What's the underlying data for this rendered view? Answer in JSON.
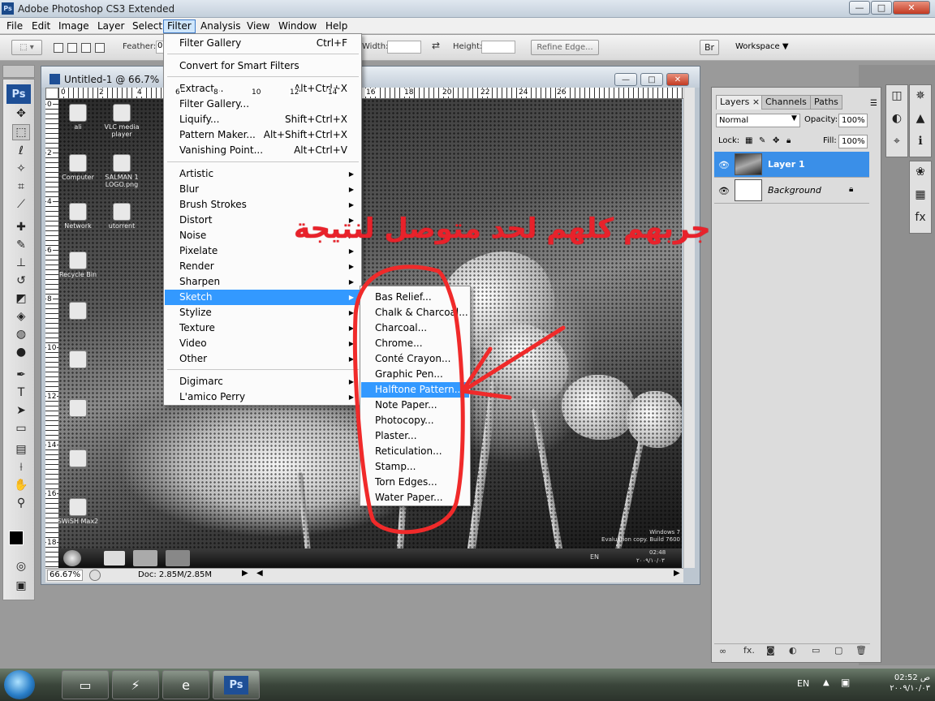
{
  "app": {
    "title": "Adobe Photoshop CS3 Extended",
    "logo": "Ps"
  },
  "window_controls": {
    "minimize": "—",
    "maximize": "□",
    "close": "✕"
  },
  "menubar": [
    "File",
    "Edit",
    "Image",
    "Layer",
    "Select",
    "Filter",
    "Analysis",
    "View",
    "Window",
    "Help"
  ],
  "options": {
    "feather_label": "Feather:",
    "feather_value": "0",
    "width_label": "Width:",
    "height_label": "Height:",
    "refine_edge": "Refine Edge...",
    "workspace": "Workspace ▼"
  },
  "document": {
    "title": "Untitled-1 @ 66.7% (La",
    "zoom": "66.67%",
    "doc_size": "Doc: 2.85M/2.85M",
    "ruler_top": [
      "0",
      "2",
      "4",
      "6",
      "8",
      "10",
      "12",
      "14",
      "16",
      "18",
      "20",
      "22",
      "24",
      "26"
    ],
    "ruler_left": [
      "0",
      "2",
      "4",
      "6",
      "8",
      "10",
      "12",
      "14",
      "16",
      "18"
    ],
    "desktop_icons": [
      "ali",
      "VLC media player",
      "Computer",
      "SALMAN 1 LOGO.png",
      "Network",
      "utorrent",
      "Recycle Bin",
      "",
      "",
      "",
      "",
      "SWiSH Max2"
    ],
    "watermark_line1": "Windows 7",
    "watermark_line2": "Evaluation copy. Build 7600",
    "canvas_tray_lang": "EN",
    "canvas_clock_time": "02:48",
    "canvas_clock_date": "۲۰۰۹/۱۰/۰۳"
  },
  "filter_menu": {
    "top": [
      {
        "label": "Filter Gallery",
        "shortcut": "Ctrl+F"
      },
      {
        "label": "Convert for Smart Filters",
        "shortcut": ""
      },
      {
        "label": "Extract...",
        "shortcut": "Alt+Ctrl+X"
      },
      {
        "label": "Filter Gallery...",
        "shortcut": ""
      },
      {
        "label": "Liquify...",
        "shortcut": "Shift+Ctrl+X"
      },
      {
        "label": "Pattern Maker...",
        "shortcut": "Alt+Shift+Ctrl+X"
      },
      {
        "label": "Vanishing Point...",
        "shortcut": "Alt+Ctrl+V"
      }
    ],
    "submenus": [
      "Artistic",
      "Blur",
      "Brush Strokes",
      "Distort",
      "Noise",
      "Pixelate",
      "Render",
      "Sharpen",
      "Sketch",
      "Stylize",
      "Texture",
      "Video",
      "Other"
    ],
    "plugins": [
      "Digimarc",
      "L'amico Perry"
    ],
    "highlighted": "Sketch"
  },
  "sketch_menu": {
    "items": [
      "Bas Relief...",
      "Chalk & Charcoal...",
      "Charcoal...",
      "Chrome...",
      "Conté Crayon...",
      "Graphic Pen...",
      "Halftone Pattern...",
      "Note Paper...",
      "Photocopy...",
      "Plaster...",
      "Reticulation...",
      "Stamp...",
      "Torn Edges...",
      "Water Paper..."
    ],
    "highlighted": "Halftone Pattern..."
  },
  "annotation": {
    "text": "جربهم كلهم لحد متوصل لنتيجة",
    "color": "#e8222b"
  },
  "layers_panel": {
    "tabs": [
      "Layers",
      "Channels",
      "Paths"
    ],
    "blend_mode": "Normal",
    "opacity_label": "Opacity:",
    "opacity": "100%",
    "lock_label": "Lock:",
    "fill_label": "Fill:",
    "fill": "100%",
    "layers": [
      {
        "name": "Layer 1",
        "selected": true
      },
      {
        "name": "Background",
        "selected": false
      }
    ],
    "footer_fx": "fx."
  },
  "taskbar": {
    "lang": "EN",
    "time": "02:52 ص",
    "date": "۲۰۰۹/۱۰/۰۳",
    "ps_button": "Ps"
  },
  "colors": {
    "highlight": "#3399ff",
    "annotation": "#e8222b",
    "selected_layer": "#3a8fe8"
  }
}
